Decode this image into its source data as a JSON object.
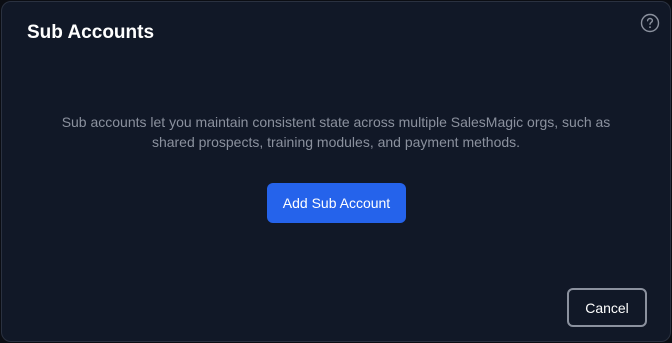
{
  "dialog": {
    "title": "Sub Accounts",
    "help_icon": "question-circle-icon",
    "description": "Sub accounts let you maintain consistent state across multiple SalesMagic orgs, such as shared prospects, training modules, and payment methods.",
    "add_button_label": "Add Sub Account",
    "cancel_button_label": "Cancel"
  },
  "colors": {
    "background": "#111827",
    "accent": "#2563eb",
    "muted_text": "#8b919e"
  }
}
